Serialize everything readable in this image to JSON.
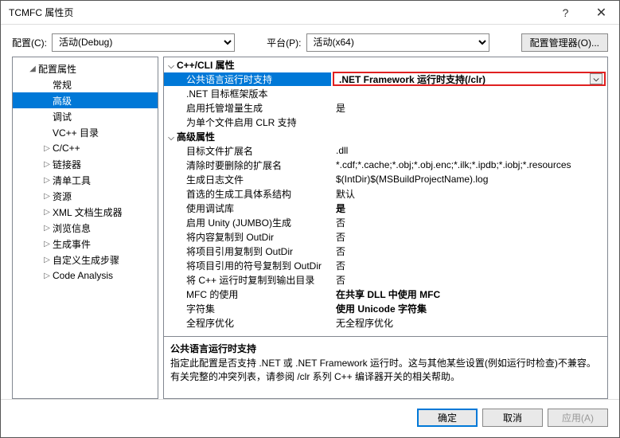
{
  "window": {
    "title": "TCMFC 属性页"
  },
  "topbar": {
    "config_label": "配置(C):",
    "config_value": "活动(Debug)",
    "platform_label": "平台(P):",
    "platform_value": "活动(x64)",
    "cfgmgr_label": "配置管理器(O)..."
  },
  "tree": {
    "root": "配置属性",
    "items": [
      {
        "label": "常规",
        "lvl": 2
      },
      {
        "label": "高级",
        "lvl": 2,
        "sel": true
      },
      {
        "label": "调试",
        "lvl": 2
      },
      {
        "label": "VC++ 目录",
        "lvl": 2
      },
      {
        "label": "C/C++",
        "lvl": 2,
        "exp": false
      },
      {
        "label": "链接器",
        "lvl": 2,
        "exp": false
      },
      {
        "label": "清单工具",
        "lvl": 2,
        "exp": false
      },
      {
        "label": "资源",
        "lvl": 2,
        "exp": false
      },
      {
        "label": "XML 文档生成器",
        "lvl": 2,
        "exp": false
      },
      {
        "label": "浏览信息",
        "lvl": 2,
        "exp": false
      },
      {
        "label": "生成事件",
        "lvl": 2,
        "exp": false
      },
      {
        "label": "自定义生成步骤",
        "lvl": 2,
        "exp": false
      },
      {
        "label": "Code Analysis",
        "lvl": 2,
        "exp": false
      }
    ]
  },
  "grid": {
    "cat1": "C++/CLI 属性",
    "rows1": [
      {
        "k": "公共语言运行时支持",
        "v": ".NET Framework 运行时支持(/clr)",
        "sel": true
      },
      {
        "k": ".NET 目标框架版本",
        "v": ""
      },
      {
        "k": "启用托管增量生成",
        "v": "是"
      },
      {
        "k": "为单个文件启用 CLR 支持",
        "v": ""
      }
    ],
    "cat2": "高级属性",
    "rows2": [
      {
        "k": "目标文件扩展名",
        "v": ".dll"
      },
      {
        "k": "清除时要删除的扩展名",
        "v": "*.cdf;*.cache;*.obj;*.obj.enc;*.ilk;*.ipdb;*.iobj;*.resources"
      },
      {
        "k": "生成日志文件",
        "v": "$(IntDir)$(MSBuildProjectName).log"
      },
      {
        "k": "首选的生成工具体系结构",
        "v": "默认"
      },
      {
        "k": "使用调试库",
        "v": "是",
        "bold": true
      },
      {
        "k": "启用 Unity (JUMBO)生成",
        "v": "否"
      },
      {
        "k": "将内容复制到 OutDir",
        "v": "否"
      },
      {
        "k": "将项目引用复制到 OutDir",
        "v": "否"
      },
      {
        "k": "将项目引用的符号复制到 OutDir",
        "v": "否"
      },
      {
        "k": "将 C++ 运行时复制到输出目录",
        "v": "否"
      },
      {
        "k": "MFC 的使用",
        "v": "在共享 DLL 中使用 MFC",
        "bold": true
      },
      {
        "k": "字符集",
        "v": "使用 Unicode 字符集",
        "bold": true
      },
      {
        "k": "全程序优化",
        "v": "无全程序优化"
      }
    ]
  },
  "desc": {
    "title": "公共语言运行时支持",
    "body": "指定此配置是否支持 .NET 或 .NET Framework 运行时。这与其他某些设置(例如运行时检查)不兼容。有关完整的冲突列表，请参阅 /clr 系列 C++ 编译器开关的相关帮助。"
  },
  "footer": {
    "ok": "确定",
    "cancel": "取消",
    "apply": "应用(A)"
  }
}
